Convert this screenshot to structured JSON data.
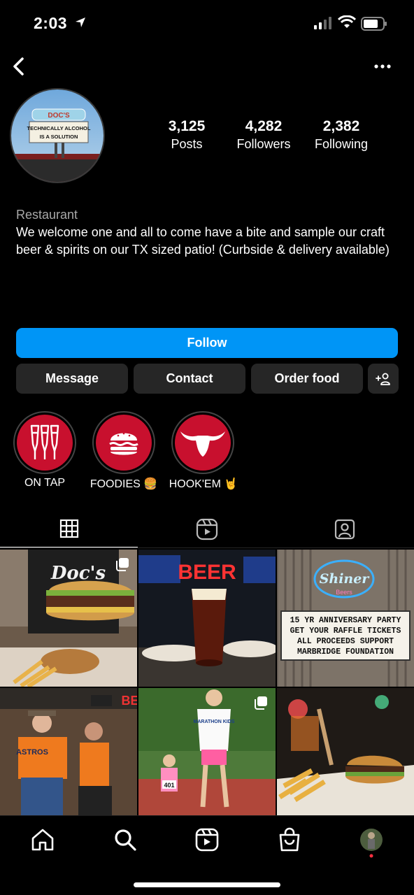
{
  "status_bar": {
    "time": "2:03"
  },
  "profile": {
    "posts_count": "3,125",
    "posts_label": "Posts",
    "followers_count": "4,282",
    "followers_label": "Followers",
    "following_count": "2,382",
    "following_label": "Following",
    "avatar_sign_line1": "TECHNICALLY ALCOHOL",
    "avatar_sign_line2": "IS A SOLUTION",
    "avatar_sign_brand": "DOC'S"
  },
  "bio": {
    "category": "Restaurant",
    "text": "We welcome one and all to come have a bite and sample our craft beer & spirits on our TX sized patio! (Curbside & delivery available)"
  },
  "actions": {
    "follow": "Follow",
    "message": "Message",
    "contact": "Contact",
    "order_food": "Order food"
  },
  "highlights": [
    {
      "label": "ON TAP",
      "icon": "beer-taps-icon"
    },
    {
      "label": "FOODIES 🍔",
      "icon": "burger-icon"
    },
    {
      "label": "HOOK'EM 🤘",
      "icon": "longhorn-icon"
    }
  ],
  "posts": {
    "beer_sign": "BEER",
    "shiner_sign": "Shiner",
    "shiner_sub": "Beers",
    "marquee": [
      "15 YR ANNIVERSARY PARTY",
      "GET YOUR RAFFLE TICKETS",
      "ALL PROCEEDS SUPPORT",
      "MARBRIDGE FOUNDATION"
    ],
    "shirt_text": "Doc's",
    "jersey_text": "ASTROS",
    "runner_shirt": "MARATHON KIDS",
    "bib": "401",
    "partial_sign": "BE"
  },
  "colors": {
    "follow_blue": "#0095f6",
    "button_gray": "#262626",
    "highlight_red": "#c8102e"
  }
}
